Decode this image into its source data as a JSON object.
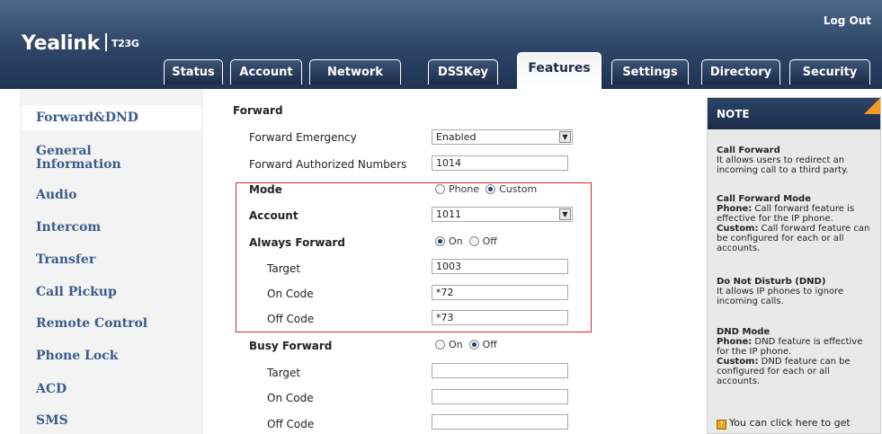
{
  "header": {
    "logo_brand": "Yealink",
    "logo_model": "T23G",
    "logout_label": "Log Out"
  },
  "tabs": [
    {
      "label": "Status"
    },
    {
      "label": "Account"
    },
    {
      "label": "Network"
    },
    {
      "label": "DSSKey"
    },
    {
      "label": "Features"
    },
    {
      "label": "Settings"
    },
    {
      "label": "Directory"
    },
    {
      "label": "Security"
    }
  ],
  "active_tab": "Features",
  "sidebar": {
    "items": [
      {
        "label": "Forward&DND"
      },
      {
        "label": "General"
      },
      {
        "label": "Information"
      },
      {
        "label": "Audio"
      },
      {
        "label": "Intercom"
      },
      {
        "label": "Transfer"
      },
      {
        "label": "Call Pickup"
      },
      {
        "label": "Remote Control"
      },
      {
        "label": "Phone Lock"
      },
      {
        "label": "ACD"
      },
      {
        "label": "SMS"
      }
    ],
    "active": "Forward&DND"
  },
  "form": {
    "section_title": "Forward",
    "forward_emergency": {
      "label": "Forward Emergency",
      "value": "Enabled"
    },
    "forward_authorized_numbers": {
      "label": "Forward Authorized Numbers",
      "value": "1014"
    },
    "mode": {
      "label": "Mode",
      "option_phone": "Phone",
      "option_custom": "Custom",
      "selected": "Custom"
    },
    "account": {
      "label": "Account",
      "value": "1011"
    },
    "always_forward": {
      "label": "Always Forward",
      "option_on": "On",
      "option_off": "Off",
      "selected": "On",
      "target_label": "Target",
      "target_value": "1003",
      "on_code_label": "On Code",
      "on_code_value": "*72",
      "off_code_label": "Off Code",
      "off_code_value": "*73"
    },
    "busy_forward": {
      "label": "Busy Forward",
      "option_on": "On",
      "option_off": "Off",
      "selected": "Off",
      "target_label": "Target",
      "target_value": "",
      "on_code_label": "On Code",
      "on_code_value": "",
      "off_code_label": "Off Code",
      "off_code_value": ""
    }
  },
  "note": {
    "title": "NOTE",
    "call_forward_title": "Call Forward",
    "call_forward_text": "It allows users to redirect an incoming call to a third party.",
    "call_forward_mode_title": "Call Forward Mode",
    "phone_label": "Phone:",
    "call_forward_mode_phone": "Call forward feature is effective for the IP phone.",
    "custom_label": "Custom:",
    "call_forward_mode_custom": "Call forward feature can be configured for each or all accounts.",
    "dnd_title": "Do Not Disturb (DND)",
    "dnd_text": "It allows IP phones to ignore incoming calls.",
    "dnd_mode_title": "DND Mode",
    "dnd_mode_phone": "DND feature is effective for the IP phone.",
    "dnd_mode_custom": "DND feature can be configured for each or all accounts.",
    "help_text": "You can click here to get"
  },
  "colors": {
    "header_dark": "#1f3354",
    "sidebar_link": "#3b5b8a",
    "highlight_box": "#d9262a",
    "note_corner": "#f39b1e"
  }
}
